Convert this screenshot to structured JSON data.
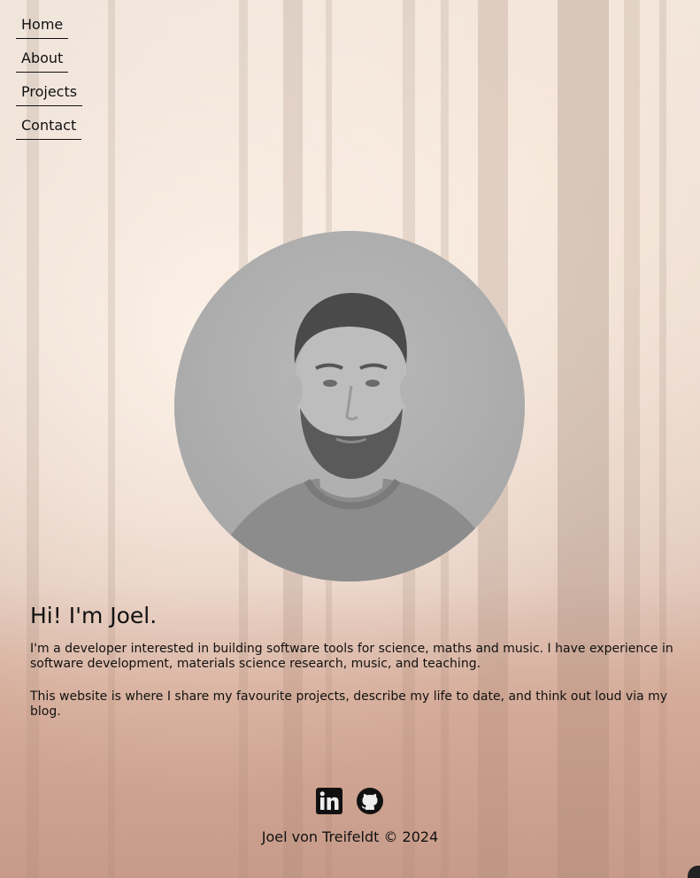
{
  "nav": {
    "items": [
      {
        "label": "Home"
      },
      {
        "label": "About"
      },
      {
        "label": "Projects"
      },
      {
        "label": "Contact"
      }
    ]
  },
  "hero": {
    "heading": "Hi! I'm Joel.",
    "paragraph1": "I'm a developer interested in building software tools for science, maths and music. I have experience in software development, materials science research, music, and teaching.",
    "paragraph2": "This website is where I share my favourite projects, describe my life to date, and think out loud via my blog."
  },
  "social": {
    "icons": [
      "linkedin-icon",
      "github-icon"
    ]
  },
  "footer": {
    "text": "Joel von Treifeldt © 2024"
  }
}
